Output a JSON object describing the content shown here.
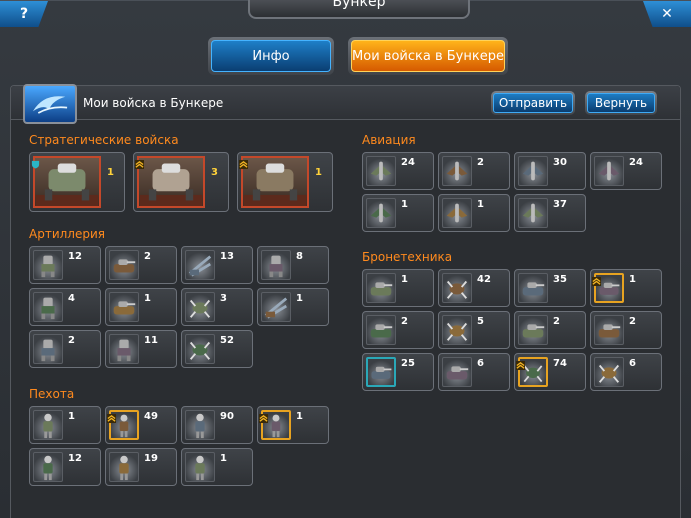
{
  "window": {
    "title": "Бункер",
    "help_label": "?",
    "close_label": "✕"
  },
  "tabs": [
    {
      "label": "Инфо",
      "active": false
    },
    {
      "label": "Мои войска в Бункере",
      "active": true
    }
  ],
  "header": {
    "title": "Мои войска в Бункере",
    "send_label": "Отправить",
    "return_label": "Вернуть"
  },
  "sections": {
    "strategic": {
      "title": "Стратегические войска",
      "units": [
        {
          "count": "1",
          "icon": "walker-mech-icon",
          "frame": "teal"
        },
        {
          "count": "3",
          "icon": "spider-mech-icon",
          "frame": "gold"
        },
        {
          "count": "1",
          "icon": "heavy-mech-icon",
          "frame": "gold"
        }
      ]
    },
    "artillery": {
      "title": "Артиллерия",
      "units": [
        {
          "count": "12",
          "icon": "mech-icon"
        },
        {
          "count": "2",
          "icon": "tank-icon"
        },
        {
          "count": "13",
          "icon": "launcher-icon"
        },
        {
          "count": "8",
          "icon": "mech-icon"
        },
        {
          "count": "4",
          "icon": "mech-icon"
        },
        {
          "count": "1",
          "icon": "tank-icon"
        },
        {
          "count": "3",
          "icon": "crawler-icon"
        },
        {
          "count": "1",
          "icon": "launcher-icon"
        },
        {
          "count": "2",
          "icon": "mech-icon"
        },
        {
          "count": "11",
          "icon": "mech-icon"
        },
        {
          "count": "52",
          "icon": "crawler-icon"
        }
      ]
    },
    "infantry": {
      "title": "Пехота",
      "units": [
        {
          "count": "1",
          "icon": "soldier-icon"
        },
        {
          "count": "49",
          "icon": "soldier-icon",
          "rank": true
        },
        {
          "count": "90",
          "icon": "soldier-icon"
        },
        {
          "count": "1",
          "icon": "soldier-icon",
          "rank": true
        },
        {
          "count": "12",
          "icon": "soldier-icon"
        },
        {
          "count": "19",
          "icon": "soldier-icon"
        },
        {
          "count": "1",
          "icon": "soldier-icon"
        }
      ]
    },
    "aviation": {
      "title": "Авиация",
      "units": [
        {
          "count": "24",
          "icon": "aircraft-icon"
        },
        {
          "count": "2",
          "icon": "aircraft-icon"
        },
        {
          "count": "30",
          "icon": "aircraft-icon"
        },
        {
          "count": "24",
          "icon": "aircraft-icon"
        },
        {
          "count": "1",
          "icon": "aircraft-icon"
        },
        {
          "count": "1",
          "icon": "aircraft-icon"
        },
        {
          "count": "37",
          "icon": "aircraft-icon"
        }
      ]
    },
    "armor": {
      "title": "Бронетехника",
      "units": [
        {
          "count": "1",
          "icon": "tank-icon"
        },
        {
          "count": "42",
          "icon": "crawler-icon"
        },
        {
          "count": "35",
          "icon": "tank-icon"
        },
        {
          "count": "1",
          "icon": "tank-icon",
          "rank": true
        },
        {
          "count": "2",
          "icon": "tank-icon"
        },
        {
          "count": "5",
          "icon": "crawler-icon"
        },
        {
          "count": "2",
          "icon": "tank-icon"
        },
        {
          "count": "2",
          "icon": "tank-icon"
        },
        {
          "count": "25",
          "icon": "tank-icon",
          "frame": "teal"
        },
        {
          "count": "6",
          "icon": "tank-icon"
        },
        {
          "count": "74",
          "icon": "crawler-icon",
          "rank": true
        },
        {
          "count": "6",
          "icon": "crawler-icon"
        }
      ]
    }
  },
  "colors": {
    "section_title": "#ff8a1e",
    "active_tab": "#ff9a12",
    "button_blue": "#1d7cc4"
  }
}
